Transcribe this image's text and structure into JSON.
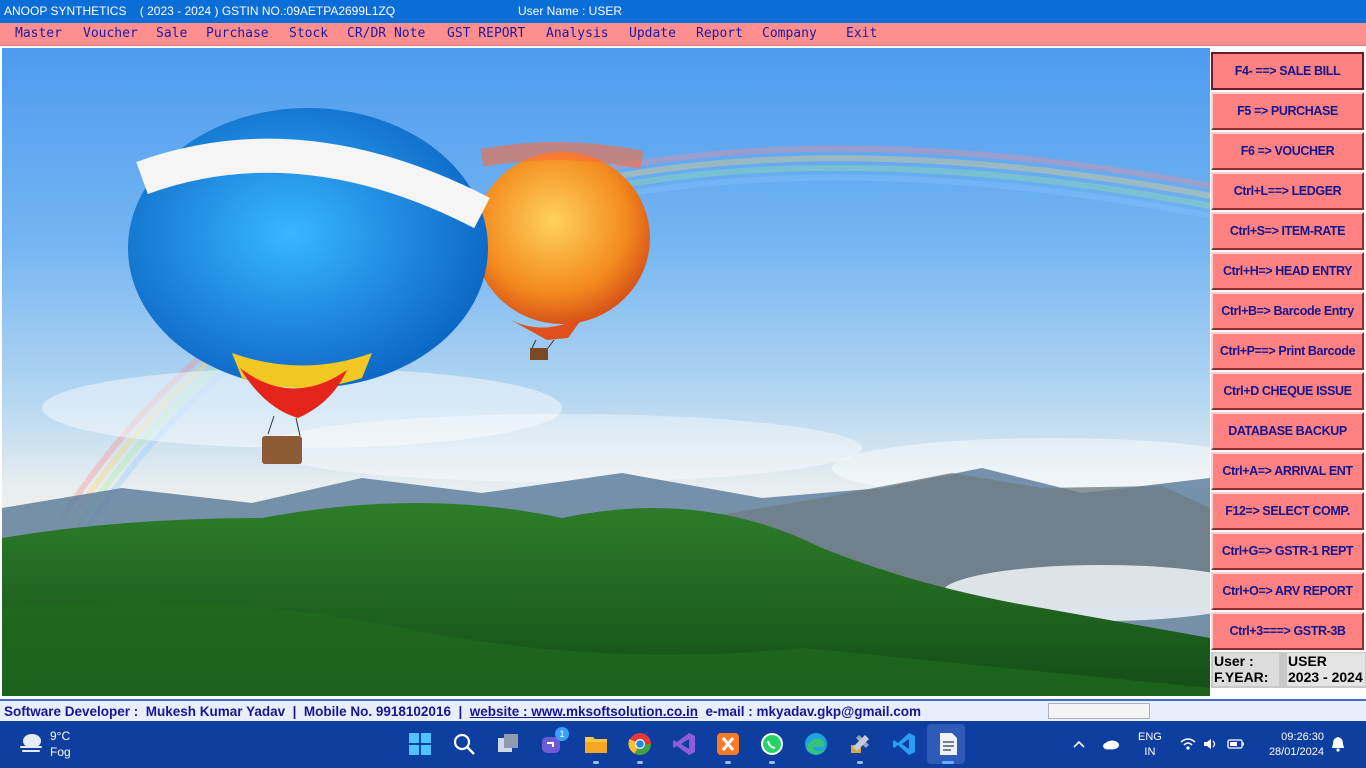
{
  "titlebar": {
    "company_line": "ANOOP SYNTHETICS    ( 2023 - 2024 ) GSTIN NO.:09AETPA2699L1ZQ",
    "user_line": "User Name : USER"
  },
  "menu": [
    "Master",
    "Voucher",
    "Sale",
    "Purchase",
    "Stock",
    "CR/DR Note",
    "GST REPORT",
    "Analysis",
    "Update",
    "Report",
    "Company",
    "Exit"
  ],
  "shortcuts": [
    "F4- ==> SALE BILL",
    "F5 => PURCHASE",
    "F6 => VOUCHER",
    "Ctrl+L==> LEDGER",
    "Ctrl+S=> ITEM-RATE",
    "Ctrl+H=> HEAD ENTRY",
    "Ctrl+B=> Barcode Entry",
    "Ctrl+P==> Print Barcode",
    "Ctrl+D CHEQUE ISSUE",
    "DATABASE BACKUP",
    "Ctrl+A=> ARRIVAL ENT",
    "F12=> SELECT COMP.",
    "Ctrl+G=> GSTR-1 REPT",
    "Ctrl+O=> ARV REPORT",
    "Ctrl+3===> GSTR-3B"
  ],
  "info": {
    "user_label": "User    :",
    "user_value": "USER",
    "year_label": "F.YEAR:",
    "year_value": "2023 - 2024"
  },
  "footer": {
    "developer": "Software Developer :  Mukesh Kumar Yadav  |  Mobile No. 9918102016  |  ",
    "website": "website : www.mksoftsolution.co.in",
    "email": "  e-mail : mkyadav.gkp@gmail.com"
  },
  "taskbar": {
    "temperature": "9°C",
    "condition": "Fog",
    "lang_top": "ENG",
    "lang_bottom": "IN",
    "time": "09:26:30",
    "date": "28/01/2024",
    "chat_badge": "1",
    "apps": [
      "start-icon",
      "search-icon",
      "task-view-icon",
      "teams-chat-icon",
      "file-explorer-icon",
      "chrome-icon",
      "visual-studio-icon",
      "xampp-icon",
      "whatsapp-icon",
      "edge-icon",
      "tools-icon",
      "vscode-icon",
      "document-app-icon"
    ]
  },
  "colors": {
    "titlebar": "#0b6dd8",
    "menubar": "#ff8f8f",
    "menu_text": "#1a1aa8",
    "button": "#ff8282",
    "taskbar": "#0e3fa0"
  }
}
